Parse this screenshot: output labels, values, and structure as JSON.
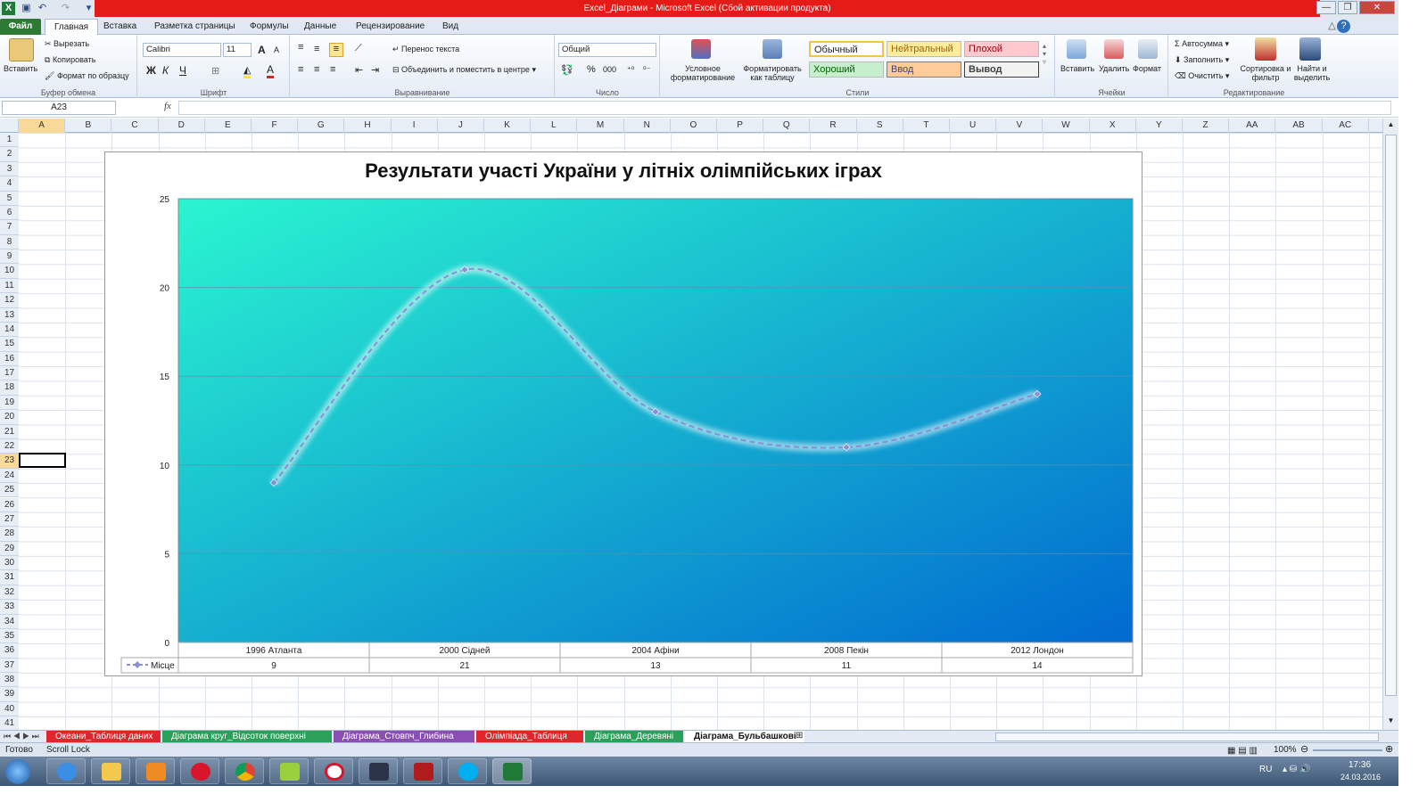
{
  "window": {
    "title": "Excel_Діаграми  -  Microsoft Excel (Сбой активации продукта)",
    "minimize": "—",
    "restore": "❐",
    "close": "✕"
  },
  "tabs": [
    "Файл",
    "Главная",
    "Вставка",
    "Разметка страницы",
    "Формулы",
    "Данные",
    "Рецензирование",
    "Вид"
  ],
  "ribbon": {
    "clipboard": {
      "paste": "Вставить",
      "cut": "Вырезать",
      "copy": "Копировать",
      "format_painter": "Формат по образцу",
      "label": "Буфер обмена"
    },
    "font": {
      "name": "Calibri",
      "size": "11",
      "bold": "Ж",
      "italic": "К",
      "underline": "Ч",
      "grow": "A",
      "shrink": "A",
      "font_color": "A",
      "label": "Шрифт"
    },
    "alignment": {
      "wrap_text": "Перенос текста",
      "merge_center": "Объединить и поместить в центре",
      "label": "Выравнивание"
    },
    "number": {
      "format": "Общий",
      "percent": "%",
      "thousands": "000",
      "label": "Число"
    },
    "styles": {
      "conditional": "Условное форматирование",
      "as_table": "Форматировать как таблицу",
      "normal": "Обычный",
      "neutral": "Нейтральный",
      "bad": "Плохой",
      "good": "Хороший",
      "input": "Ввод",
      "output": "Вывод",
      "label": "Стили"
    },
    "cells": {
      "insert": "Вставить",
      "delete": "Удалить",
      "format": "Формат",
      "label": "Ячейки"
    },
    "editing": {
      "autosum": "Автосумма",
      "fill": "Заполнить",
      "clear": "Очистить",
      "sort": "Сортировка и фильтр",
      "find": "Найти и выделить",
      "label": "Редактирование"
    }
  },
  "formula_bar": {
    "name_box": "A23",
    "fx": "fx",
    "value": ""
  },
  "columns": [
    "A",
    "B",
    "C",
    "D",
    "E",
    "F",
    "G",
    "H",
    "I",
    "J",
    "K",
    "L",
    "M",
    "N",
    "O",
    "P",
    "Q",
    "R",
    "S",
    "T",
    "U",
    "V",
    "W",
    "X",
    "Y",
    "Z",
    "AA",
    "AB",
    "AC"
  ],
  "rows": [
    "1",
    "2",
    "3",
    "4",
    "5",
    "6",
    "7",
    "8",
    "9",
    "10",
    "11",
    "12",
    "13",
    "14",
    "15",
    "16",
    "17",
    "18",
    "19",
    "20",
    "21",
    "22",
    "23",
    "24",
    "25",
    "26",
    "27",
    "28",
    "29",
    "30",
    "31",
    "32",
    "33",
    "34",
    "35",
    "36",
    "37",
    "38",
    "39",
    "40",
    "41"
  ],
  "chart_data": {
    "type": "line",
    "title": "Результати участі України у літніх олімпійських іграх",
    "categories": [
      "1996 Атланта",
      "2000 Сідней",
      "2004 Афіни",
      "2008 Пекін",
      "2012 Лондон"
    ],
    "series": [
      {
        "name": "Місце",
        "values": [
          9,
          21,
          13,
          11,
          14
        ]
      }
    ],
    "y_ticks": [
      "0",
      "5",
      "10",
      "15",
      "20",
      "25"
    ],
    "ylim": [
      0,
      25
    ],
    "smooth": true,
    "data_table": true,
    "grid": true,
    "line_color": "#8a8fd6",
    "plot_gradient": [
      "#2af5d0",
      "#006ad0"
    ]
  },
  "sheet_tabs": [
    {
      "label": "Океани_Таблиця даних",
      "color": "#e0262d"
    },
    {
      "label": "Діаграма круг_Відсоток поверхні",
      "color": "#2aa05a"
    },
    {
      "label": "Діаграма_Стовпч_Глибина",
      "color": "#8b4fb3"
    },
    {
      "label": "Олімпіада_Таблиця",
      "color": "#e0262d"
    },
    {
      "label": "Діаграма_Деревяні",
      "color": "#2aa05a"
    },
    {
      "label": "Діаграма_Бульбашкові",
      "color": "#ffffff"
    }
  ],
  "status": {
    "ready": "Готово",
    "scroll_lock": "Scroll Lock",
    "zoom": "100%"
  },
  "taskbar": {
    "lang": "RU",
    "time": "17:36",
    "date": "24.03.2016"
  }
}
